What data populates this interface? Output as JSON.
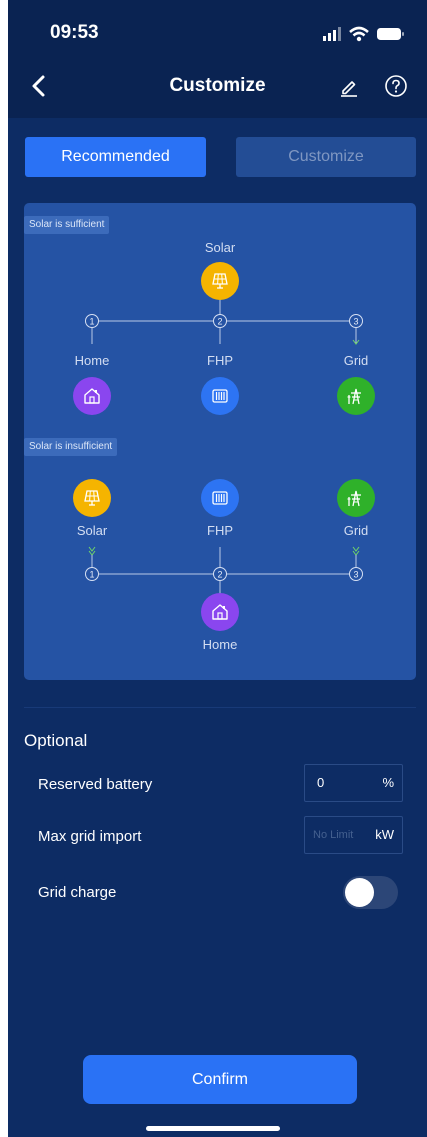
{
  "status": {
    "time": "09:53"
  },
  "header": {
    "title": "Customize"
  },
  "segments": {
    "recommended": "Recommended",
    "customize": "Customize",
    "selected": "Recommended"
  },
  "diagram": {
    "sufficient": {
      "tag": "Solar is sufficient",
      "source": "Solar",
      "markers": [
        "1",
        "2",
        "3"
      ],
      "targets": [
        "Home",
        "FHP",
        "Grid"
      ]
    },
    "insufficient": {
      "tag": "Solar is insufficient",
      "sources": [
        "Solar",
        "FHP",
        "Grid"
      ],
      "markers": [
        "1",
        "2",
        "3"
      ],
      "target": "Home"
    },
    "icons": {
      "solar": "solar-panel-icon",
      "home": "home-icon",
      "fhp": "heat-pump-icon",
      "grid": "power-tower-icon"
    },
    "colors": {
      "solar": "#f5b400",
      "home": "#8a46ef",
      "fhp": "#2d74f3",
      "grid": "#2fb12a",
      "accent": "#2a72f5"
    }
  },
  "optional": {
    "title": "Optional",
    "reserved_battery": {
      "label": "Reserved battery",
      "value": "0",
      "unit": "%"
    },
    "max_grid_import": {
      "label": "Max grid import",
      "placeholder": "No Limit",
      "unit": "kW"
    },
    "grid_charge": {
      "label": "Grid charge",
      "enabled": false
    }
  },
  "confirm_label": "Confirm"
}
